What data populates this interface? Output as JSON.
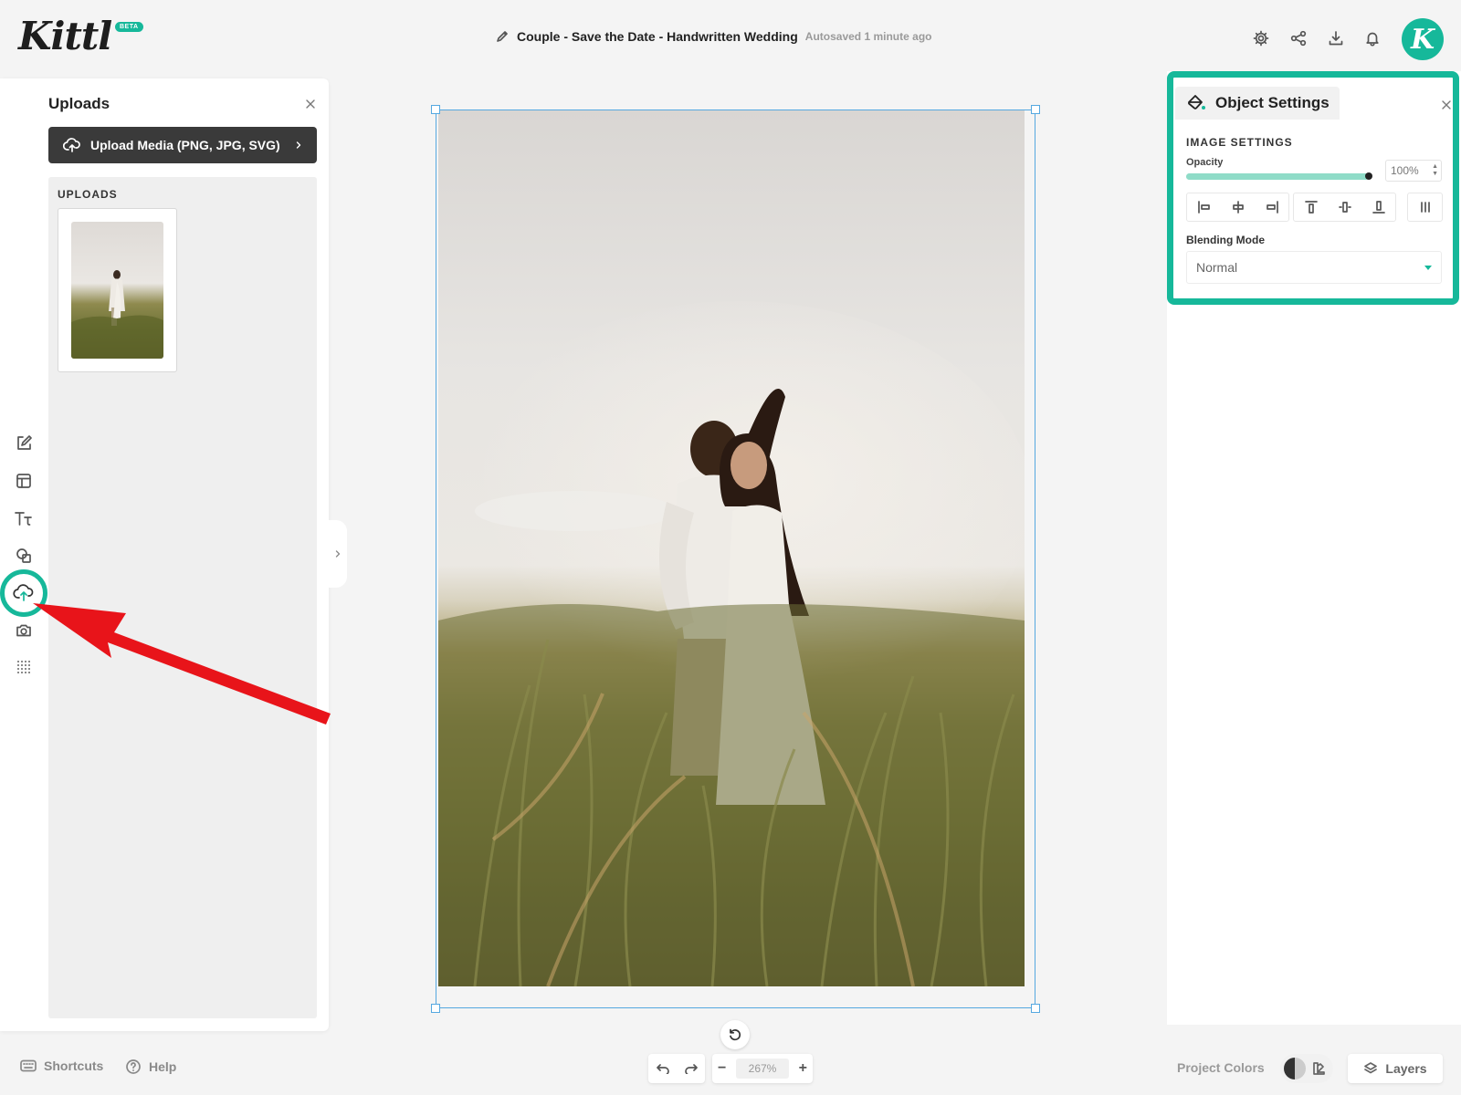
{
  "app": {
    "logo_text": "Kittl",
    "beta_badge": "BETA",
    "document_title": "Couple - Save the Date - Handwritten Wedding",
    "autosave_status": "Autosaved 1 minute ago",
    "avatar_letter": "K"
  },
  "uploads_panel": {
    "title": "Uploads",
    "upload_button_label": "Upload Media (PNG, JPG, SVG)",
    "section_heading": "UPLOADS"
  },
  "object_settings": {
    "title": "Object Settings",
    "section_title": "IMAGE SETTINGS",
    "opacity_label": "Opacity",
    "opacity_value": "100%",
    "opacity_fraction": 1.0,
    "blending_mode_label": "Blending Mode",
    "blending_mode_value": "Normal"
  },
  "canvas": {
    "zoom": "267%"
  },
  "footer": {
    "shortcuts_label": "Shortcuts",
    "help_label": "Help",
    "project_colors_label": "Project Colors",
    "layers_label": "Layers"
  },
  "colors": {
    "accent": "#16b89a",
    "annotation_arrow": "#e8141a",
    "selection": "#55a8e0"
  },
  "icons": {
    "header": [
      "pencil-icon",
      "gear-icon",
      "share-icon",
      "download-icon",
      "bell-icon"
    ],
    "left_rail": [
      "edit-icon",
      "layout-icon",
      "text-icon",
      "shapes-icon",
      "upload-cloud-icon",
      "camera-icon",
      "grid-icon"
    ],
    "alignment": [
      "align-left-icon",
      "align-center-h-icon",
      "align-right-icon",
      "align-top-icon",
      "align-middle-v-icon",
      "align-bottom-icon",
      "distribute-icon"
    ]
  }
}
